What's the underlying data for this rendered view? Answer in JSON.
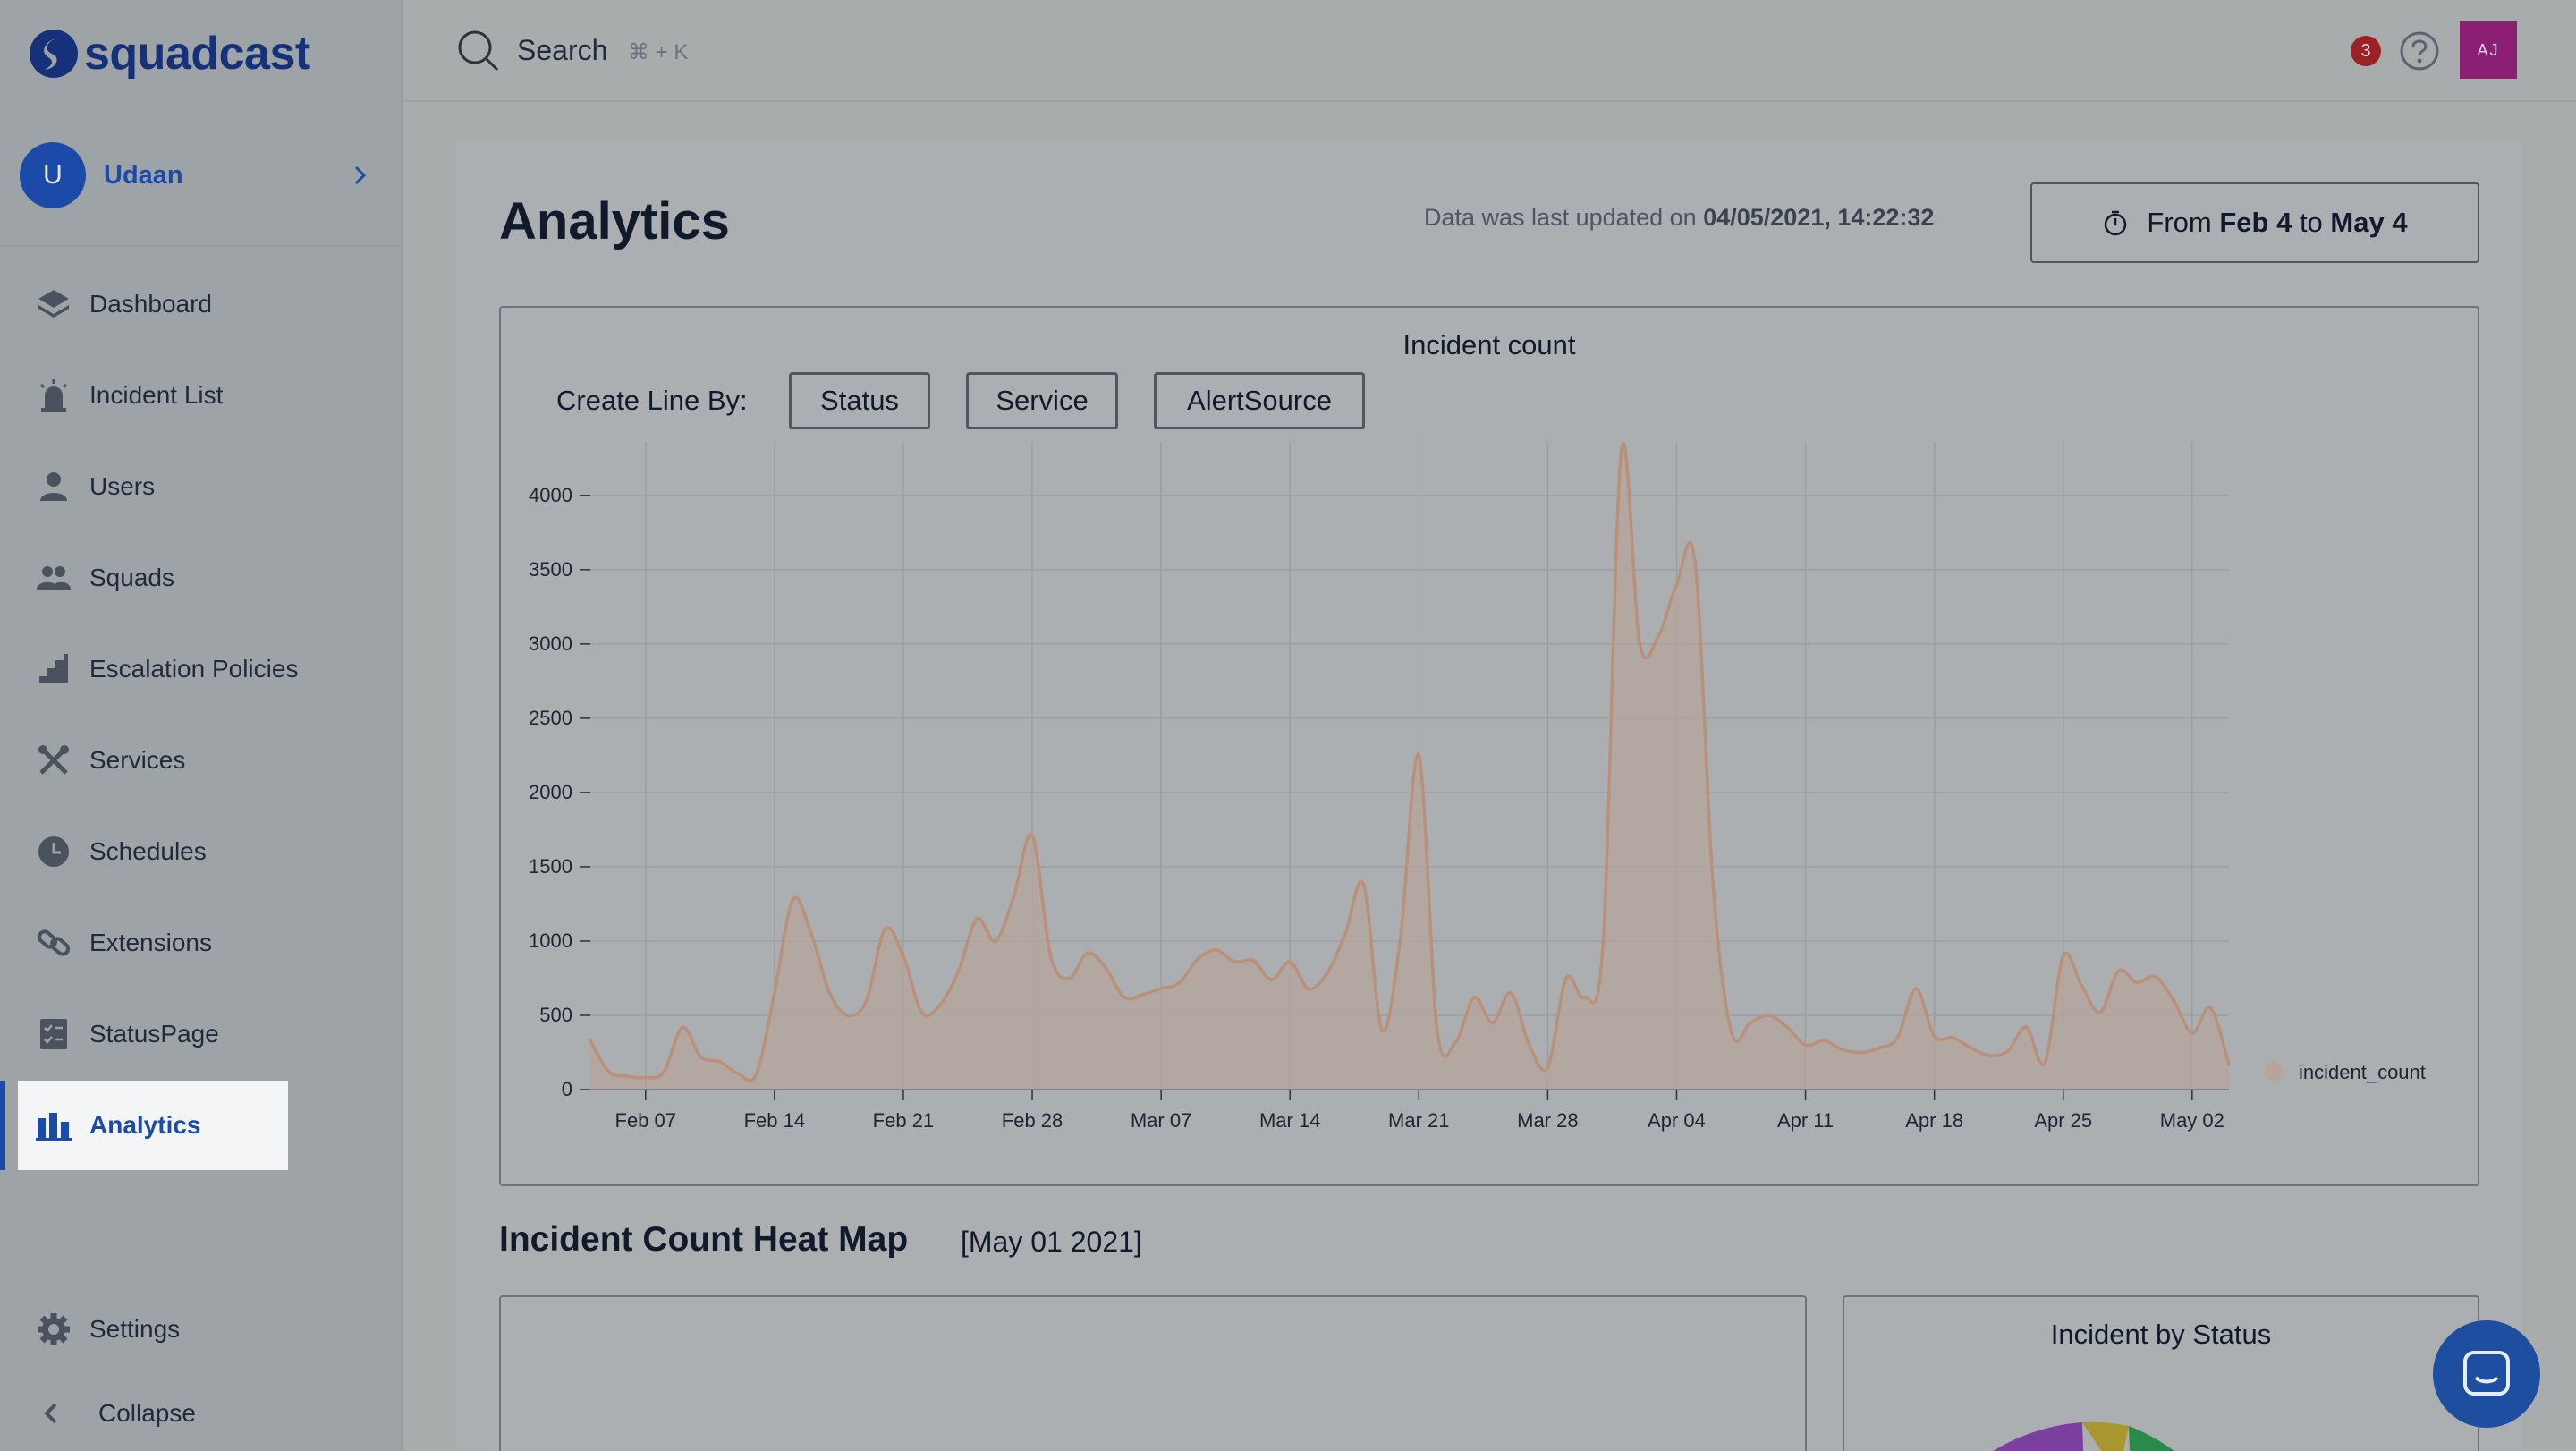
{
  "brand": {
    "name": "squadcast"
  },
  "org": {
    "initial": "U",
    "name": "Udaan"
  },
  "nav": {
    "items": [
      {
        "label": "Dashboard",
        "icon": "layers-icon"
      },
      {
        "label": "Incident List",
        "icon": "siren-icon"
      },
      {
        "label": "Users",
        "icon": "user-icon"
      },
      {
        "label": "Squads",
        "icon": "group-icon"
      },
      {
        "label": "Escalation Policies",
        "icon": "stairs-icon"
      },
      {
        "label": "Services",
        "icon": "tools-icon"
      },
      {
        "label": "Schedules",
        "icon": "clock-icon"
      },
      {
        "label": "Extensions",
        "icon": "link-icon"
      },
      {
        "label": "StatusPage",
        "icon": "checklist-icon"
      },
      {
        "label": "Analytics",
        "icon": "bar-chart-icon",
        "active": true
      }
    ],
    "settings": "Settings",
    "collapse": "Collapse"
  },
  "header": {
    "search_label": "Search",
    "search_hint": "⌘ + K",
    "notification_count": "3",
    "user_initials": "AJ"
  },
  "page": {
    "title": "Analytics",
    "updated_prefix": "Data was last updated on",
    "updated_value": "04/05/2021, 14:22:32",
    "range_from_word": "From",
    "range_from": "Feb 4",
    "range_to_word": "to",
    "range_to": "May 4"
  },
  "incident_chart": {
    "title": "Incident count",
    "line_by_label": "Create Line By:",
    "buttons": [
      "Status",
      "Service",
      "AlertSource"
    ],
    "legend": "incident_count"
  },
  "heatmap": {
    "title": "Incident Count Heat Map",
    "date": "[May 01 2021]"
  },
  "status_chart": {
    "title": "Incident by Status"
  },
  "colors": {
    "accent": "#1b4aa8",
    "line": "#b9917a",
    "fill": "#b7a49a",
    "notification": "#9a2227",
    "avatar": "#8a1f73"
  },
  "chart_data": {
    "type": "area",
    "title": "Incident count",
    "xlabel": "",
    "ylabel": "",
    "ylim": [
      0,
      4300
    ],
    "yticks": [
      0,
      500,
      1000,
      1500,
      2000,
      2500,
      3000,
      3500,
      4000
    ],
    "x_tick_labels": [
      "Feb 07",
      "Feb 14",
      "Feb 21",
      "Feb 28",
      "Mar 07",
      "Mar 14",
      "Mar 21",
      "Mar 28",
      "Apr 04",
      "Apr 11",
      "Apr 18",
      "Apr 25",
      "May 02"
    ],
    "x_start": "2021-02-04",
    "grid": true,
    "legend_position": "right",
    "series": [
      {
        "name": "incident_count",
        "values": [
          330,
          120,
          90,
          80,
          120,
          420,
          220,
          190,
          110,
          100,
          650,
          1280,
          1050,
          650,
          500,
          600,
          1080,
          900,
          520,
          570,
          800,
          1150,
          1000,
          1300,
          1710,
          900,
          750,
          920,
          820,
          620,
          640,
          680,
          720,
          880,
          940,
          860,
          870,
          740,
          860,
          680,
          780,
          1050,
          1380,
          400,
          1020,
          2250,
          400,
          320,
          620,
          450,
          650,
          300,
          150,
          750,
          620,
          980,
          4300,
          3000,
          3050,
          3400,
          3550,
          1350,
          380,
          450,
          500,
          420,
          300,
          330,
          270,
          250,
          280,
          350,
          680,
          360,
          350,
          280,
          230,
          260,
          420,
          180,
          900,
          700,
          520,
          800,
          720,
          760,
          600,
          380,
          550,
          170
        ]
      }
    ]
  }
}
